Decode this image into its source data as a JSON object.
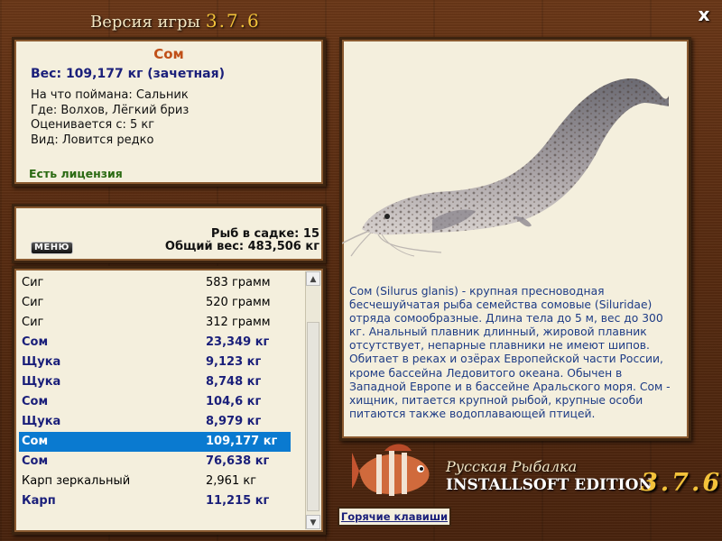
{
  "window": {
    "title": "Версия игры",
    "version": "3.7.6",
    "close_label": "x"
  },
  "catch_info": {
    "fish_name": "Сом",
    "weight": "Вес: 109,177 кг (зачетная)",
    "bait": "На что поймана: Сальник",
    "location": "Где: Волхов, Лёгкий бриз",
    "valued_from": "Оценивается с: 5 кг",
    "rarity": "Вид: Ловится редко",
    "license": "Есть лицензия"
  },
  "stats": {
    "menu_label": "МЕНЮ",
    "fish_count": "Рыб в садке: 15",
    "total_weight": "Общий вес: 483,506 кг"
  },
  "fish_list": [
    {
      "name": "Сиг",
      "weight": "583 грамм",
      "highlight": false,
      "selected": false
    },
    {
      "name": "Сиг",
      "weight": "520 грамм",
      "highlight": false,
      "selected": false
    },
    {
      "name": "Сиг",
      "weight": "312 грамм",
      "highlight": false,
      "selected": false
    },
    {
      "name": "Сом",
      "weight": "23,349 кг",
      "highlight": true,
      "selected": false
    },
    {
      "name": "Щука",
      "weight": "9,123 кг",
      "highlight": true,
      "selected": false
    },
    {
      "name": "Щука",
      "weight": "8,748 кг",
      "highlight": true,
      "selected": false
    },
    {
      "name": "Сом",
      "weight": "104,6 кг",
      "highlight": true,
      "selected": false
    },
    {
      "name": "Щука",
      "weight": "8,979 кг",
      "highlight": true,
      "selected": false
    },
    {
      "name": "Сом",
      "weight": "109,177 кг",
      "highlight": true,
      "selected": true
    },
    {
      "name": "Сом",
      "weight": "76,638 кг",
      "highlight": true,
      "selected": false
    },
    {
      "name": "Карп зеркальный",
      "weight": "2,961 кг",
      "highlight": false,
      "selected": false
    },
    {
      "name": "Карп",
      "weight": "11,215 кг",
      "highlight": true,
      "selected": false
    }
  ],
  "description": "Сом (Silurus glanis) - крупная пресноводная бесчешуйчатая рыба семейства сомовые (Siluridae) отряда сомообразные. Длина тела до 5 м, вес до 300 кг. Анальный плавник длинный, жировой плавник отсутствует, непарные плавники не имеют шипов. Обитает в реках и озёрах Европейской части России, кроме бассейна Ледовитого океана. Обычен в Западной Европе и в бассейне Аральского моря. Сом - хищник, питается крупной рыбой, крупные особи питаются также водоплавающей птицей.",
  "logo": {
    "line1": "Русская Рыбалка",
    "line2": "INSTALLSOFT EDITION",
    "version": "3.7.6"
  },
  "hotkeys_label": "Горячие клавиши",
  "colors": {
    "wood": "#5a2d12",
    "panel": "#f4efdd",
    "accent_blue": "#1a1f7a",
    "selection": "#0a7ad0",
    "fish_name": "#c05018",
    "license_green": "#2a6a12",
    "version_gold": "#f3c23a"
  }
}
